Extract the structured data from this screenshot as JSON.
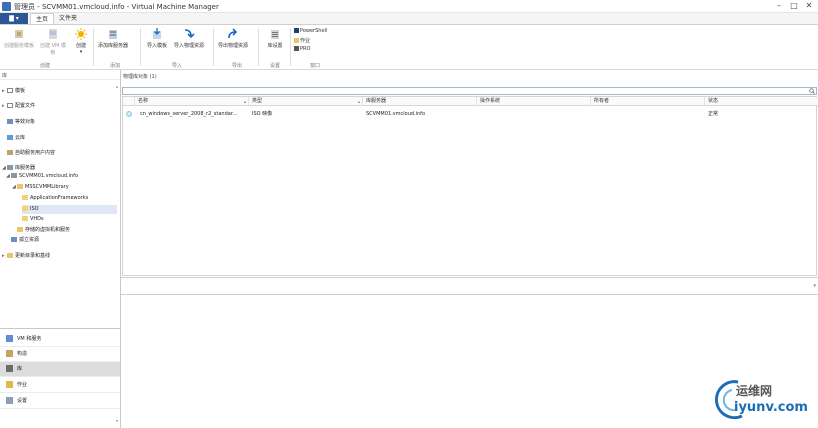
{
  "window": {
    "title": "管理员 - SCVMM01.vmcloud.info - Virtual Machine Manager"
  },
  "tabs": {
    "file": "",
    "home": "主页",
    "folder": "文件夹"
  },
  "ribbon": {
    "buttons": {
      "create_template": "创建服务模板",
      "create_vm_template": "创建 VM 模板",
      "create": "创建",
      "add_library_server": "添加库服务器",
      "import_template": "导入模板",
      "import_physical": "导入物理资源",
      "export_physical": "导出物理资源",
      "library_settings": "库设置"
    },
    "small_buttons": {
      "powershell": "PowerShell",
      "jobs": "作业",
      "pro": "PRO"
    },
    "groups": {
      "create": "创建",
      "add": "添加",
      "import": "导入",
      "export": "导出",
      "settings": "设置",
      "window": "窗口"
    }
  },
  "left_pane": {
    "header": "库",
    "tree": [
      "模板",
      "配置文件",
      "等效对象",
      "云库",
      "自助服务用户内容",
      "库服务器",
      "SCVMM01.vmcloud.info",
      "MSSCVMMLibrary",
      "ApplicationFrameworks",
      "ISO",
      "VHDs",
      "存储的虚拟机和服务",
      "孤立资源",
      "更新目录和基线"
    ],
    "workspaces": [
      "VM 和服务",
      "构造",
      "库",
      "作业",
      "设置"
    ]
  },
  "main": {
    "header": "物理库对象 (1)",
    "columns": [
      "名称",
      "类型",
      "库服务器",
      "操作系统",
      "所有者",
      "状态"
    ],
    "rows": [
      {
        "name": "cn_windows_server_2008_r2_standar...",
        "type": "ISO 映像",
        "server": "SCVMM01.vmcloud.info",
        "os": "",
        "owner": "",
        "status": "正常"
      }
    ]
  },
  "watermark": {
    "brand": "运维网",
    "url": "iyunv.com"
  },
  "colors": {
    "accent": "#2b5797",
    "selection": "#dde8f4",
    "watermark": "#1a6fb4"
  }
}
